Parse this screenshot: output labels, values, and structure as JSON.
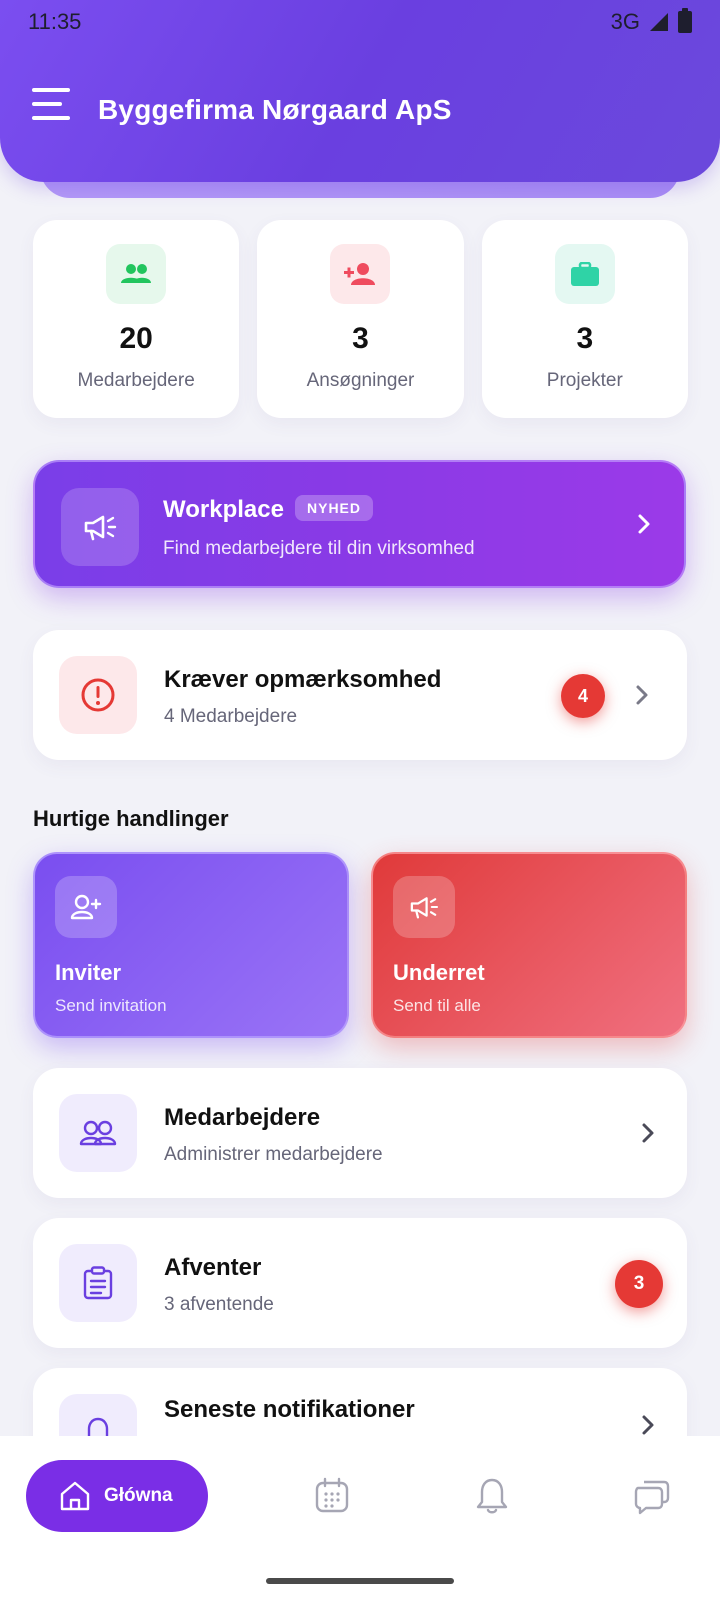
{
  "status_bar": {
    "time": "11:35",
    "network": "3G"
  },
  "header": {
    "title": "Byggefirma Nørgaard ApS"
  },
  "stats": [
    {
      "value": "20",
      "label": "Medarbejdere",
      "icon": "people-icon",
      "color": "#22c55e",
      "bg": "#e6f8ec"
    },
    {
      "value": "3",
      "label": "Ansøgninger",
      "icon": "person-add-icon",
      "color": "#ef4b5e",
      "bg": "#fde8ea"
    },
    {
      "value": "3",
      "label": "Projekter",
      "icon": "briefcase-icon",
      "color": "#2fd3a6",
      "bg": "#e4f8f2"
    }
  ],
  "workplace": {
    "title": "Workplace",
    "badge": "NYHED",
    "subtitle": "Find medarbejdere til din virksomhed"
  },
  "attention": {
    "title": "Kræver opmærksomhed",
    "subtitle": "4 Medarbejdere",
    "count": "4"
  },
  "quick_actions": {
    "title": "Hurtige handlinger",
    "items": [
      {
        "title": "Inviter",
        "subtitle": "Send invitation"
      },
      {
        "title": "Underret",
        "subtitle": "Send til alle"
      }
    ]
  },
  "list": [
    {
      "title": "Medarbejdere",
      "subtitle": "Administrer medarbejdere"
    },
    {
      "title": "Afventer",
      "subtitle": "3 afventende",
      "count": "3"
    },
    {
      "title": "Seneste notifikationer"
    }
  ],
  "bottom_nav": {
    "home_label": "Główna"
  },
  "colors": {
    "primary": "#7a2ee6",
    "danger": "#e53935"
  }
}
